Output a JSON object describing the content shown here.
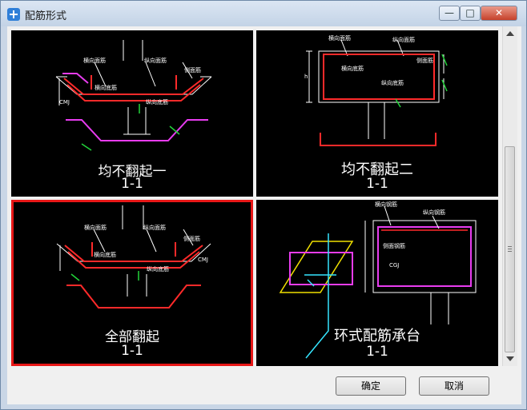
{
  "window": {
    "title": "配筋形式"
  },
  "controls": {
    "minimize": "—",
    "maximize": "□",
    "close": "✕"
  },
  "tiles": [
    {
      "caption": "均不翻起一",
      "section": "1-1",
      "selected": false,
      "labels": {
        "hx": "横向面筋",
        "zx": "纵向面筋",
        "hd": "横向底筋",
        "zd": "纵向底筋",
        "side": "侧面筋",
        "cm": "CMJ"
      }
    },
    {
      "caption": "均不翻起二",
      "section": "1-1",
      "selected": false,
      "labels": {
        "hx": "横向面筋",
        "zx": "纵向面筋",
        "hd": "横向底筋",
        "zd": "纵向底筋",
        "side": "侧面筋",
        "h": "h"
      }
    },
    {
      "caption": "全部翻起",
      "section": "1-1",
      "selected": true,
      "labels": {
        "hx": "横向面筋",
        "zx": "纵向面筋",
        "hd": "横向底筋",
        "zd": "纵向底筋",
        "side": "侧面筋",
        "cm": "CMJ"
      }
    },
    {
      "caption": "环式配筋承台",
      "section": "1-1",
      "selected": false,
      "labels": {
        "hx": "横向钢筋",
        "zx": "纵向钢筋",
        "side": "侧面钢筋",
        "code": "CGJ"
      }
    }
  ],
  "buttons": {
    "ok": "确定",
    "cancel": "取消"
  },
  "colors": {
    "rebar": "#ff2a2a",
    "magenta": "#e83cf0",
    "dim": "#ffffff",
    "label": "#ffffff",
    "cyan": "#35e6ff",
    "yellow": "#f0e000",
    "green": "#22d43a"
  }
}
